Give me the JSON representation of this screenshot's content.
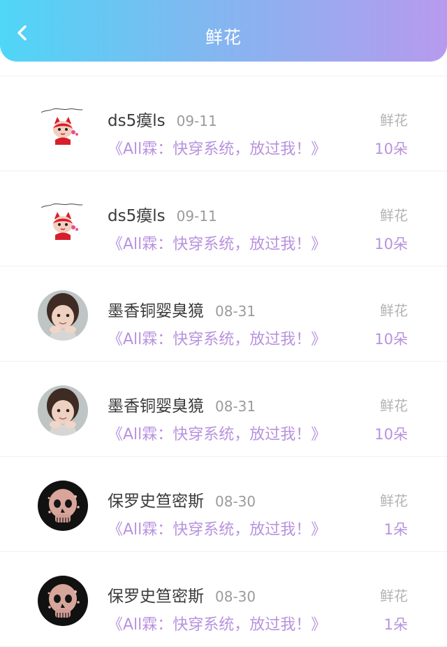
{
  "header": {
    "title": "鲜花",
    "back_icon": "chevron-left-icon",
    "gradient": [
      "#4fd6f7",
      "#80b8f0",
      "#b79aee"
    ]
  },
  "colors": {
    "accent": "#b892df",
    "name": "#3a3a3a",
    "muted": "#9b9b9b"
  },
  "items": [
    {
      "avatar": "cartoon-fox-avatar",
      "name": "ds5瘼ls",
      "date": "09-11",
      "book": "《All霖：快穿系统，放过我！》",
      "gift": "鲜花",
      "count": "10朵"
    },
    {
      "avatar": "cartoon-fox-avatar",
      "name": "ds5瘼ls",
      "date": "09-11",
      "book": "《All霖：快穿系统，放过我！》",
      "gift": "鲜花",
      "count": "10朵"
    },
    {
      "avatar": "child-photo-avatar",
      "name": "墨香铜婴臭獍",
      "date": "08-31",
      "book": "《All霖：快穿系统，放过我！》",
      "gift": "鲜花",
      "count": "10朵"
    },
    {
      "avatar": "child-photo-avatar",
      "name": "墨香铜婴臭獍",
      "date": "08-31",
      "book": "《All霖：快穿系统，放过我！》",
      "gift": "鲜花",
      "count": "10朵"
    },
    {
      "avatar": "skull-flower-avatar",
      "name": "保罗史笪密斯",
      "date": "08-30",
      "book": "《All霖：快穿系统，放过我！》",
      "gift": "鲜花",
      "count": "1朵"
    },
    {
      "avatar": "skull-flower-avatar",
      "name": "保罗史笪密斯",
      "date": "08-30",
      "book": "《All霖：快穿系统，放过我！》",
      "gift": "鲜花",
      "count": "1朵"
    }
  ]
}
